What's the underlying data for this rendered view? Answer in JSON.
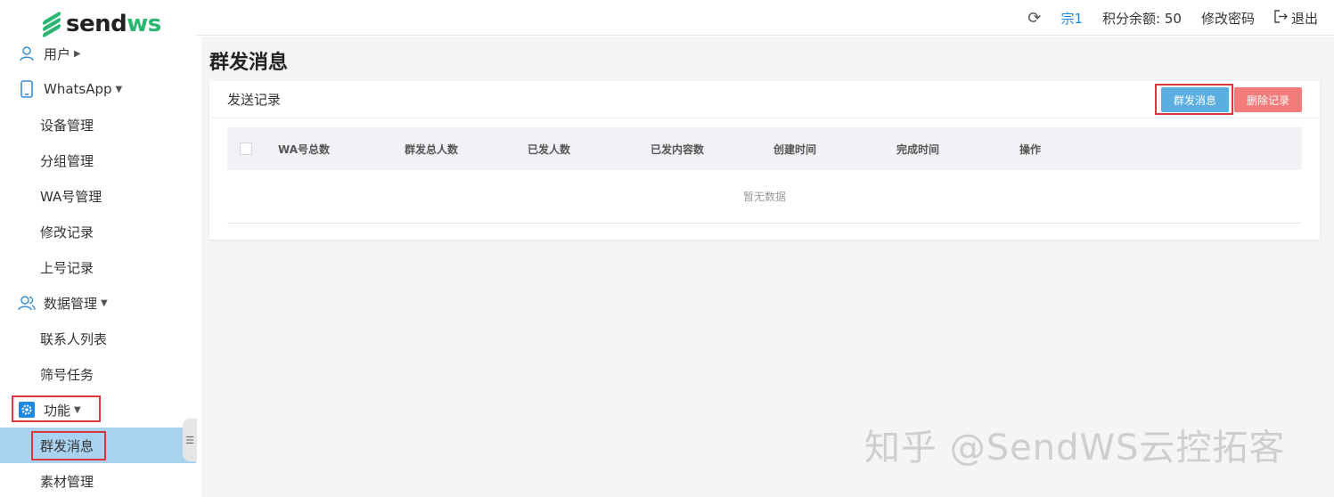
{
  "brand": {
    "logo_part1": "send",
    "logo_part2": "ws"
  },
  "topbar": {
    "user": "宗1",
    "points": "积分余额: 50",
    "change_password": "修改密码",
    "logout": "退出"
  },
  "sidebar": {
    "user_group": "用户",
    "whatsapp_group": "WhatsApp",
    "whatsapp_items": [
      "设备管理",
      "分组管理",
      "WA号管理",
      "修改记录",
      "上号记录"
    ],
    "data_group": "数据管理",
    "data_items": [
      "联系人列表",
      "筛号任务"
    ],
    "function_group": "功能",
    "function_items": [
      "群发消息",
      "素材管理"
    ]
  },
  "page": {
    "title": "群发消息",
    "card_title": "发送记录",
    "btn_broadcast": "群发消息",
    "btn_delete": "删除记录",
    "columns": [
      "WA号总数",
      "群发总人数",
      "已发人数",
      "已发内容数",
      "创建时间",
      "完成时间",
      "操作"
    ],
    "empty_text": "暂无数据"
  },
  "watermark": "知乎 @SendWS云控拓客",
  "colors": {
    "brand_green": "#2bb673",
    "primary": "#5aaee0",
    "danger": "#f37b7b",
    "active_bg": "#a9d1f0",
    "highlight": "#d9363e"
  }
}
